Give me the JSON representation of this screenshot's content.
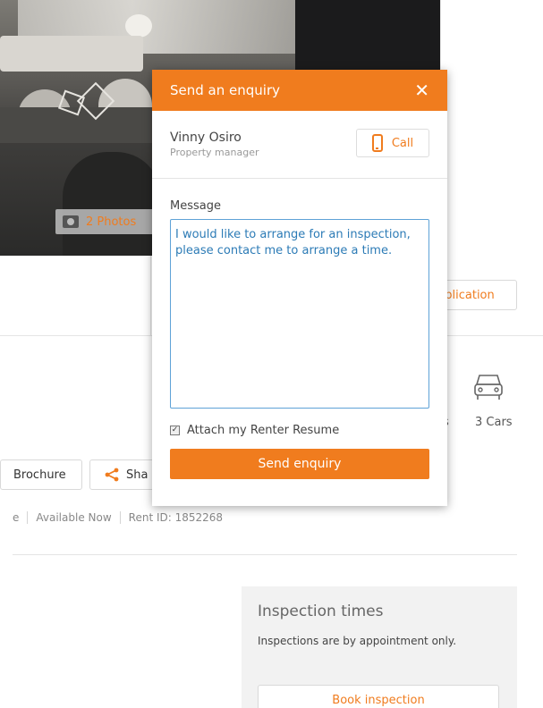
{
  "hero": {
    "photos_label": "2 Photos"
  },
  "actions": {
    "application_label": "pplication"
  },
  "features": {
    "bath_glyph": "ı",
    "partial_label": "s",
    "cars_label": "3 Cars"
  },
  "buttons": {
    "brochure_label": "Brochure",
    "share_label": "Sha"
  },
  "meta": {
    "items": [
      "e",
      "Available Now",
      "Rent ID: 1852268"
    ]
  },
  "inspection": {
    "title": "Inspection times",
    "note": "Inspections are by appointment only.",
    "book_label": "Book inspection"
  },
  "modal": {
    "title": "Send an enquiry",
    "close_glyph": "✕",
    "agent_name": "Vinny Osiro",
    "agent_role": "Property manager",
    "call_label": "Call",
    "message_label": "Message",
    "message_value": "I would like to arrange for an inspection, please contact me to arrange a time.",
    "attach_label": "Attach my Renter Resume",
    "attach_checked": true,
    "send_label": "Send enquiry"
  },
  "colors": {
    "accent": "#f07c1e",
    "input_text": "#2c7bb6"
  }
}
